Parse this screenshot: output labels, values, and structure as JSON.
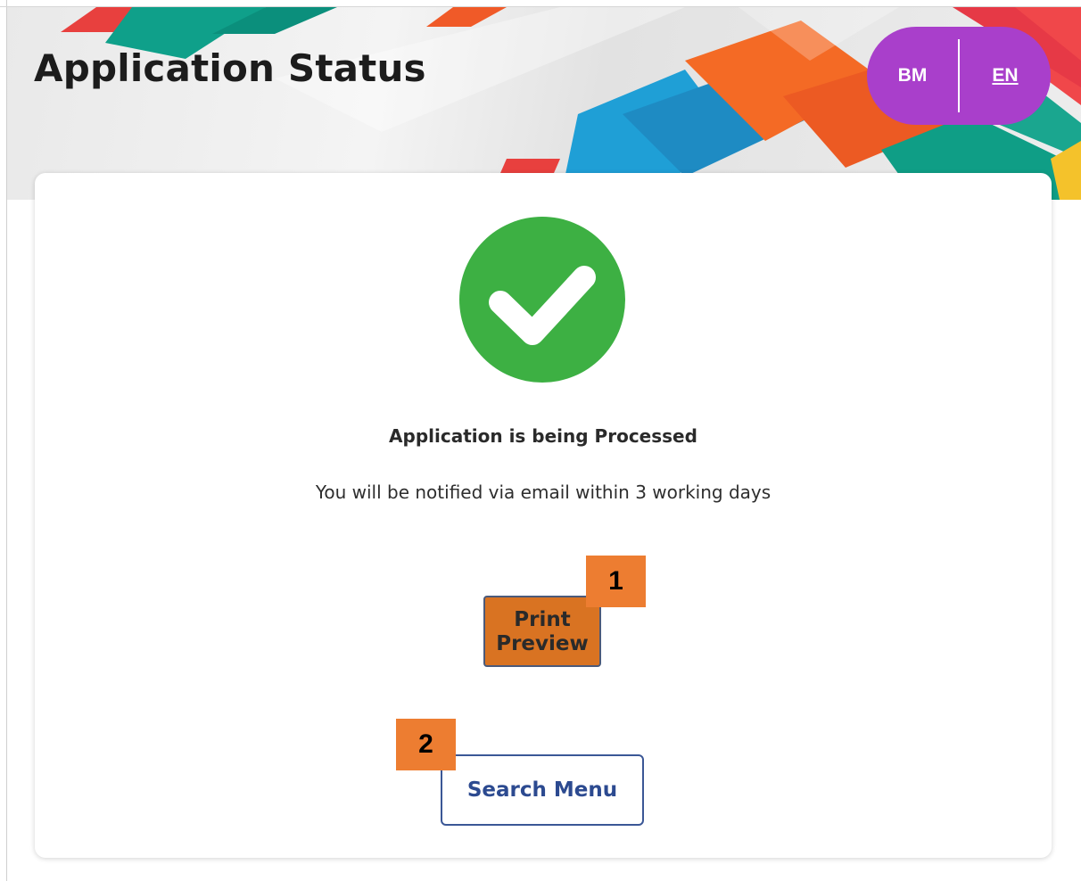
{
  "header": {
    "title": "Application Status",
    "languages": [
      "BM",
      "EN"
    ],
    "active_language": "EN",
    "toggle_color": "#a93fcb"
  },
  "status": {
    "icon": "check-circle-icon",
    "icon_color": "#3db043",
    "heading": "Application is being Processed",
    "message": "You will be notified via email within 3 working days"
  },
  "actions": {
    "print_preview_label": "Print Preview",
    "search_menu_label": "Search Menu",
    "print_preview_color": "#d97322"
  },
  "markers": [
    "1",
    "2"
  ],
  "colors": {
    "accent_orange": "#ed7d31",
    "button_blue": "#2c4a90"
  }
}
